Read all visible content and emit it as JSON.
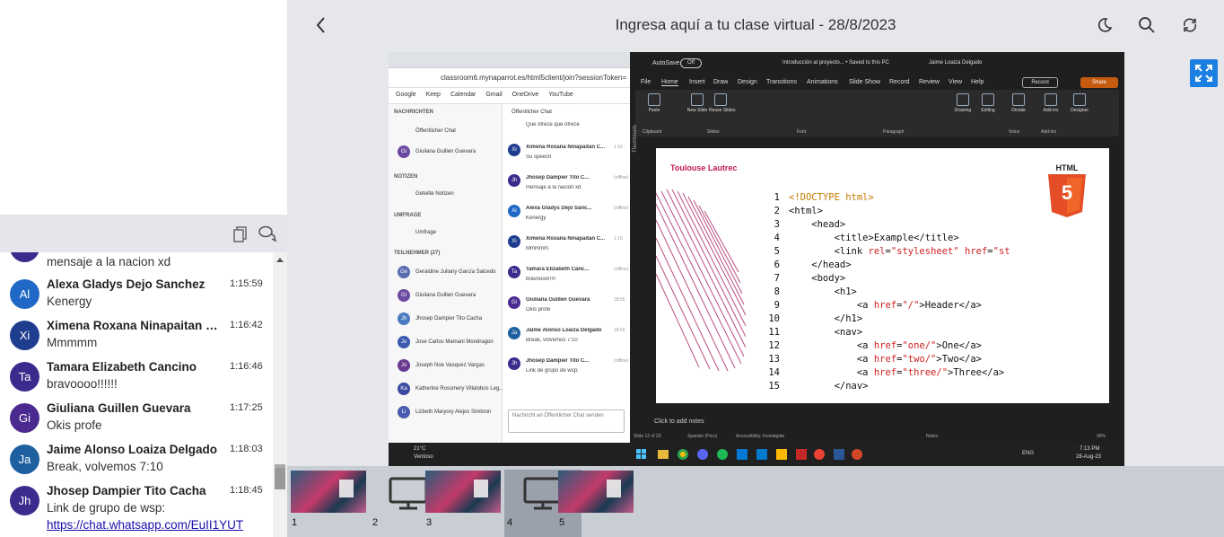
{
  "header": {
    "title": "Ingresa aquí a tu clase virtual - 28/8/2023"
  },
  "chat": {
    "partial_message": "mensaje a la nacion xd",
    "messages": [
      {
        "initials": "Al",
        "name": "Alexa Gladys Dejo Sanchez",
        "time": "1:15:59",
        "text": "Kenergy",
        "color": "#1f68c5"
      },
      {
        "initials": "Xi",
        "name": "Ximena Roxana Ninapaitan Cruzado",
        "time": "1:16:42",
        "text": "Mmmmm",
        "color": "#1f3d8f"
      },
      {
        "initials": "Ta",
        "name": "Tamara Elizabeth Cancino",
        "time": "1:16:46",
        "text": "bravoooo!!!!!!",
        "color": "#3a2b8c"
      },
      {
        "initials": "Gi",
        "name": "Giuliana Guillen Guevara",
        "time": "1:17:25",
        "text": "Okis profe",
        "color": "#4a2a8f"
      },
      {
        "initials": "Ja",
        "name": "Jaime Alonso Loaiza Delgado",
        "time": "1:18:03",
        "text": "Break, volvemos 7:10",
        "color": "#1e5fa0"
      },
      {
        "initials": "Jh",
        "name": "Jhosep Dampier Tito Cacha",
        "time": "1:18:45",
        "text": "Link de grupo de wsp:",
        "link": "https://chat.whatsapp.com/EuII1YUT",
        "color": "#3a2b8c"
      }
    ]
  },
  "shared_screen": {
    "browser": {
      "url": "classroom6.mynaparrot.es/html5client/join?sessionToken=",
      "bookmarks": [
        "Google",
        "Keep",
        "Calendar",
        "Gmail",
        "OneDrive",
        "YouTube"
      ],
      "side": {
        "messages_heading": "NACHRICHTEN",
        "public_chat": "Öffentlicher Chat",
        "private_user": "Giuliana Guillen Guevara",
        "notes_heading": "NOTIZEN",
        "shared_notes": "Geteilte Notizen",
        "poll_heading": "UMFRAGE",
        "poll": "Umfrage",
        "participants_heading": "TEILNEHMER (27)",
        "participants": [
          {
            "initials": "Ge",
            "name": "Geraldine Juliany García Salcedo",
            "color": "#5b6bb0"
          },
          {
            "initials": "Gi",
            "name": "Giuliana Guillen Guevara",
            "color": "#6a4aa0"
          },
          {
            "initials": "Jh",
            "name": "Jhosep Dampier Tito Cacha",
            "color": "#4a7ac0"
          },
          {
            "initials": "Jo",
            "name": "Jose Carlos Mamani Mondragon",
            "color": "#3a5ab0"
          },
          {
            "initials": "Jo",
            "name": "Joseph Noe Vasquez Vargas",
            "color": "#6a3a90"
          },
          {
            "initials": "Ka",
            "name": "Katherine Rossmery Villalobos Leg...",
            "color": "#3a4aa0"
          },
          {
            "initials": "Li",
            "name": "Lizbeth Maryory Alejos Simbron",
            "color": "#4a5ab0"
          }
        ]
      },
      "chat": {
        "heading": "Öffentlicher Chat",
        "top_text": "Que ofrece que ofrece",
        "items": [
          {
            "initials": "Xi",
            "name": "Ximena Roxana Ninapaitan C...",
            "time": "1:16",
            "text": "Su speech",
            "color": "#1f3d8f"
          },
          {
            "initials": "Jh",
            "name": "Jhosep Dampier Tito C...",
            "time": "(offline)",
            "text": "mensaje a la nacion xd",
            "color": "#3a2b8c"
          },
          {
            "initials": "Al",
            "name": "Alexa Gladys Dejo Sanc...",
            "time": "(offline)",
            "text": "Kenergy",
            "color": "#1f68c5"
          },
          {
            "initials": "Xi",
            "name": "Ximena Roxana Ninapaitan C...",
            "time": "1:16",
            "text": "Mmmmm",
            "color": "#1f3d8f"
          },
          {
            "initials": "Ta",
            "name": "Tamara Elizabeth Canc...",
            "time": "(offline)",
            "text": "bravoooo!!!!!",
            "color": "#3a2b8c"
          },
          {
            "initials": "Gi",
            "name": "Giuliana Guillen Guevara",
            "time": "18:55",
            "text": "Okis profe",
            "color": "#4a2a8f"
          },
          {
            "initials": "Ja",
            "name": "Jaime Alonso Loaiza Delgado",
            "time": "18:55",
            "text": "Break, volvemos 7:10",
            "color": "#1e5fa0"
          },
          {
            "initials": "Jh",
            "name": "Jhosep Dampier Tito C...",
            "time": "(offline)",
            "text": "Link de grupo de wsp:",
            "color": "#3a2b8c"
          }
        ],
        "input_placeholder": "Nachricht an Öffentlicher Chat senden"
      }
    },
    "powerpoint": {
      "autosave": "AutoSave",
      "autosave_state": "Off",
      "file_title": "Introducción al proyecto... • Saved to this PC",
      "user": "Jaime Loaiza Delgado",
      "menu": [
        "File",
        "Home",
        "Insert",
        "Draw",
        "Design",
        "Transitions",
        "Animations",
        "Slide Show",
        "Record",
        "Review",
        "View",
        "Help"
      ],
      "record_label": "Record",
      "share_label": "Share",
      "ribbon_groups": [
        "Clipboard",
        "Slides",
        "Font",
        "Paragraph",
        "Voice",
        "Add-ins"
      ],
      "ribbon_buttons": [
        "Paste",
        "New Slide",
        "Reuse Slides",
        "Drawing",
        "Editing",
        "Dictate",
        "Add-ins",
        "Designer"
      ],
      "thumbnails_label": "Thumbnails",
      "slide_title": "Toulouse Lautrec",
      "html_badge": "HTML",
      "html_number": "5",
      "code_lines": [
        "<!DOCTYPE html>",
        "<html>",
        "    <head>",
        "        <title>Example</title>",
        "        <link rel=\"stylesheet\" href=\"st",
        "    </head>",
        "    <body>",
        "        <h1>",
        "            <a href=\"/\">Header</a>",
        "        </h1>",
        "        <nav>",
        "            <a href=\"one/\">One</a>",
        "            <a href=\"two/\">Two</a>",
        "            <a href=\"three/\">Three</a>",
        "        </nav>"
      ],
      "notes_placeholder": "Click to add notes",
      "status": {
        "slide": "Slide 12 of 23",
        "language": "Spanish (Peru)",
        "accessibility": "Accessibility: Investigate",
        "notes": "Notes",
        "zoom": "99%"
      }
    },
    "taskbar": {
      "weather_temp": "21°C",
      "weather_text": "Ventoso",
      "lang": "ENG",
      "time": "7:13 PM",
      "date": "28-Aug-23"
    }
  },
  "slides": [
    {
      "number": "1",
      "type": "image"
    },
    {
      "number": "2",
      "type": "screen"
    },
    {
      "number": "3",
      "type": "image"
    },
    {
      "number": "4",
      "type": "screen",
      "active": true
    },
    {
      "number": "5",
      "type": "image"
    }
  ]
}
